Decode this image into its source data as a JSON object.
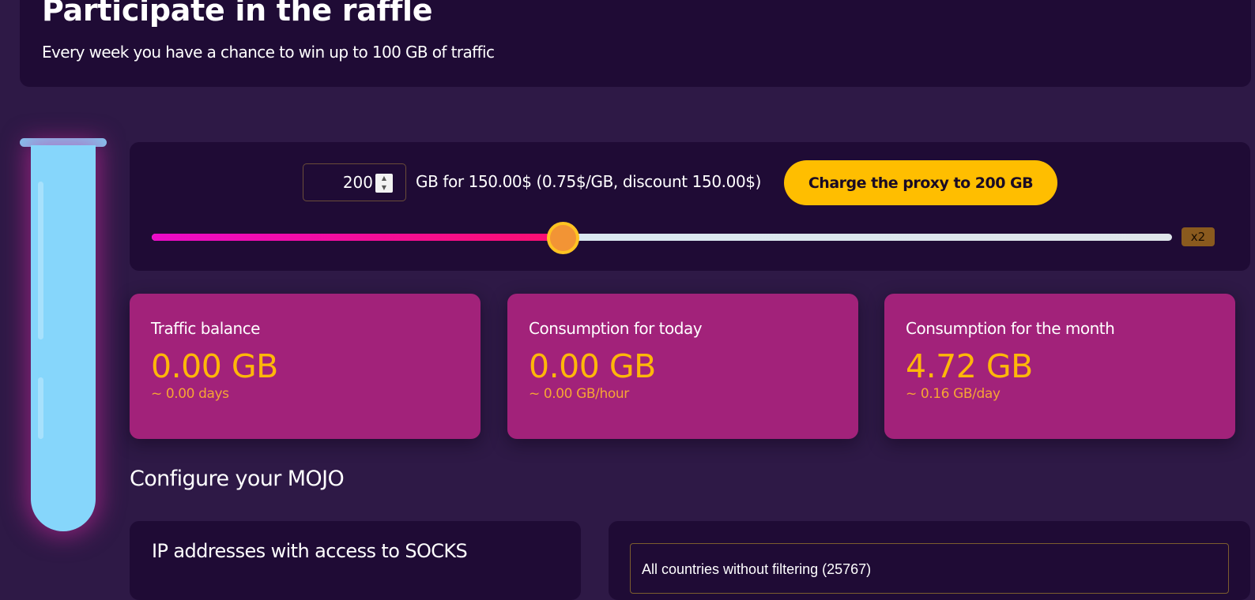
{
  "raffle": {
    "title": "Participate in the raffle",
    "subtitle": "Every week you have a chance to win up to 100 GB of traffic"
  },
  "charge": {
    "gb_value": "200",
    "price_text": "GB for 150.00$ (0.75$/GB, discount 150.00$)",
    "button_label": "Charge the proxy to 200 GB",
    "slider_fraction": 0.403,
    "multiplier_badge": "x2"
  },
  "stats": [
    {
      "label": "Traffic balance",
      "value": "0.00 GB",
      "sub": "~ 0.00 days"
    },
    {
      "label": "Consumption for today",
      "value": "0.00 GB",
      "sub": "~ 0.00 GB/hour"
    },
    {
      "label": "Consumption for the month",
      "value": "4.72 GB",
      "sub": "~ 0.16 GB/day"
    }
  ],
  "config": {
    "title": "Configure your MOJO",
    "ip_card_title": "IP addresses with access to SOCKS",
    "country_filter_selected": "All countries without filtering (25767)"
  },
  "icons": {
    "spinner_up": "chevron-up",
    "spinner_down": "chevron-down"
  },
  "colors": {
    "page_bg": "#2e1946",
    "panel_bg": "#1f0b35",
    "stat_card_bg": "#a2227a",
    "accent_yellow": "#ffbe00",
    "stat_value": "#ffb709",
    "tube": "#86d6fb",
    "slider_fill_start": "#ec0bc9",
    "slider_fill_end": "#fc0f70"
  }
}
